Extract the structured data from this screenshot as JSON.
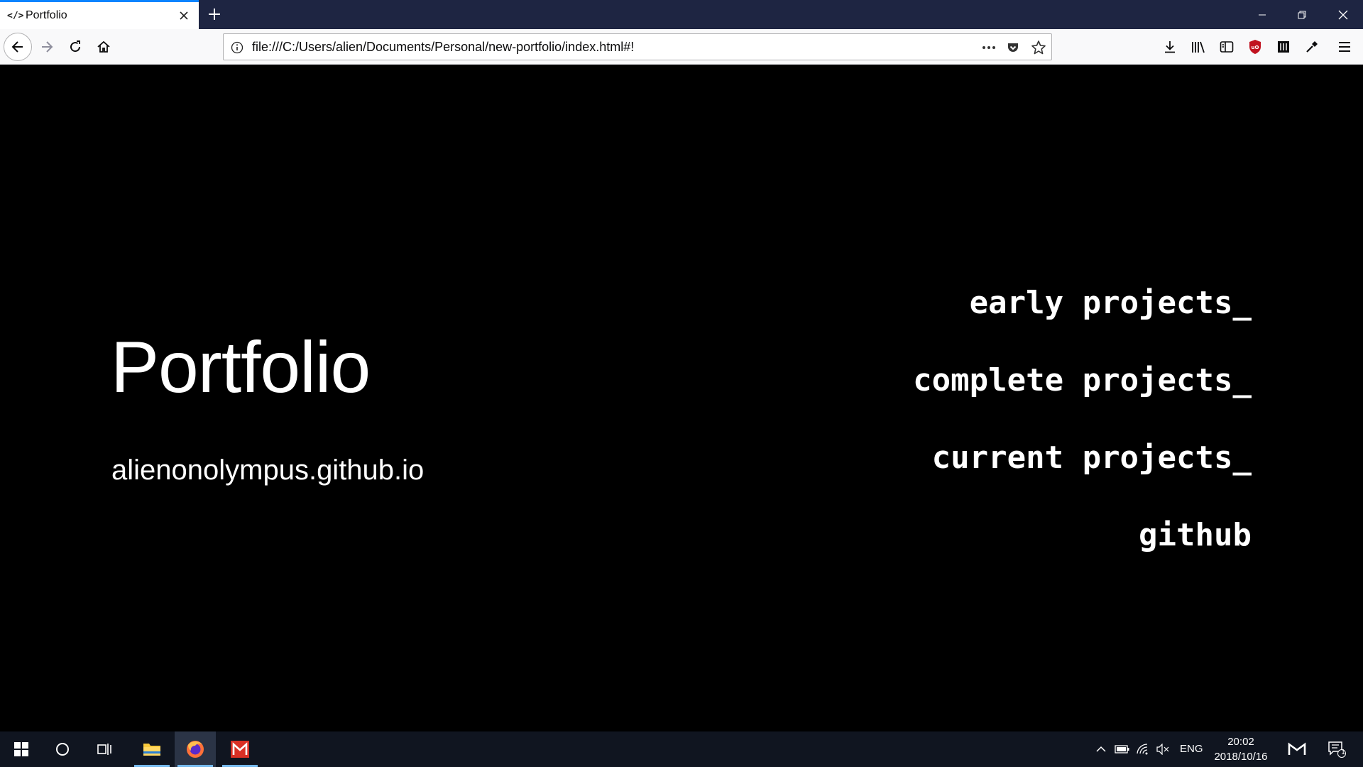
{
  "browser": {
    "tab": {
      "icon_text": "</>",
      "title": "Portfolio"
    },
    "url": "file:///C:/Users/alien/Documents/Personal/new-portfolio/index.html#!",
    "icons": {
      "back": "back-arrow-icon",
      "forward": "forward-arrow-icon",
      "reload": "reload-icon",
      "home": "home-icon",
      "info": "info-icon",
      "page_actions": "more-icon",
      "pocket": "pocket-icon",
      "bookmark": "star-icon",
      "downloads": "download-icon",
      "library": "library-icon",
      "sidebar": "sidebar-icon",
      "ublock": "ublock-icon",
      "extension": "extension-icon",
      "eyedropper": "eyedropper-icon",
      "menu": "hamburger-menu-icon"
    },
    "colors": {
      "tabstrip": "#1e2542",
      "active_tab_accent": "#0a84ff",
      "ublock": "#c1121f"
    }
  },
  "page": {
    "title": "Portfolio",
    "subtitle": "alienonolympus.github.io",
    "nav_links": [
      {
        "label": "early projects_"
      },
      {
        "label": "complete projects_"
      },
      {
        "label": "current projects_"
      },
      {
        "label": "github"
      }
    ],
    "background": "#000000",
    "text_color": "#ffffff"
  },
  "taskbar": {
    "language": "ENG",
    "time": "20:02",
    "date": "2018/10/16",
    "notification_count": "1",
    "apps": [
      "file-explorer-icon",
      "firefox-icon",
      "gmail-icon"
    ]
  }
}
